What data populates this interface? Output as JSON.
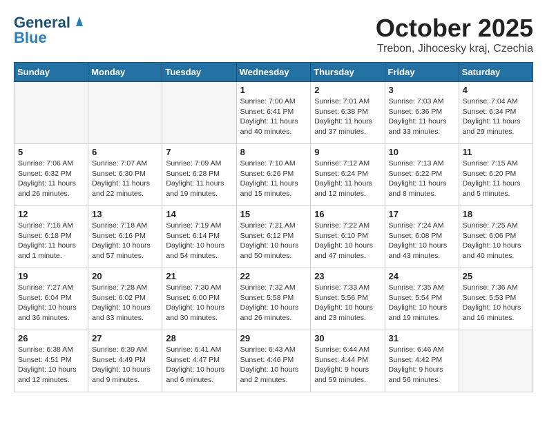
{
  "logo": {
    "part1": "General",
    "part2": "Blue"
  },
  "header": {
    "month": "October 2025",
    "location": "Trebon, Jihocesky kraj, Czechia"
  },
  "weekdays": [
    "Sunday",
    "Monday",
    "Tuesday",
    "Wednesday",
    "Thursday",
    "Friday",
    "Saturday"
  ],
  "weeks": [
    [
      {
        "day": "",
        "info": ""
      },
      {
        "day": "",
        "info": ""
      },
      {
        "day": "",
        "info": ""
      },
      {
        "day": "1",
        "info": "Sunrise: 7:00 AM\nSunset: 6:41 PM\nDaylight: 11 hours\nand 40 minutes."
      },
      {
        "day": "2",
        "info": "Sunrise: 7:01 AM\nSunset: 6:38 PM\nDaylight: 11 hours\nand 37 minutes."
      },
      {
        "day": "3",
        "info": "Sunrise: 7:03 AM\nSunset: 6:36 PM\nDaylight: 11 hours\nand 33 minutes."
      },
      {
        "day": "4",
        "info": "Sunrise: 7:04 AM\nSunset: 6:34 PM\nDaylight: 11 hours\nand 29 minutes."
      }
    ],
    [
      {
        "day": "5",
        "info": "Sunrise: 7:06 AM\nSunset: 6:32 PM\nDaylight: 11 hours\nand 26 minutes."
      },
      {
        "day": "6",
        "info": "Sunrise: 7:07 AM\nSunset: 6:30 PM\nDaylight: 11 hours\nand 22 minutes."
      },
      {
        "day": "7",
        "info": "Sunrise: 7:09 AM\nSunset: 6:28 PM\nDaylight: 11 hours\nand 19 minutes."
      },
      {
        "day": "8",
        "info": "Sunrise: 7:10 AM\nSunset: 6:26 PM\nDaylight: 11 hours\nand 15 minutes."
      },
      {
        "day": "9",
        "info": "Sunrise: 7:12 AM\nSunset: 6:24 PM\nDaylight: 11 hours\nand 12 minutes."
      },
      {
        "day": "10",
        "info": "Sunrise: 7:13 AM\nSunset: 6:22 PM\nDaylight: 11 hours\nand 8 minutes."
      },
      {
        "day": "11",
        "info": "Sunrise: 7:15 AM\nSunset: 6:20 PM\nDaylight: 11 hours\nand 5 minutes."
      }
    ],
    [
      {
        "day": "12",
        "info": "Sunrise: 7:16 AM\nSunset: 6:18 PM\nDaylight: 11 hours\nand 1 minute."
      },
      {
        "day": "13",
        "info": "Sunrise: 7:18 AM\nSunset: 6:16 PM\nDaylight: 10 hours\nand 57 minutes."
      },
      {
        "day": "14",
        "info": "Sunrise: 7:19 AM\nSunset: 6:14 PM\nDaylight: 10 hours\nand 54 minutes."
      },
      {
        "day": "15",
        "info": "Sunrise: 7:21 AM\nSunset: 6:12 PM\nDaylight: 10 hours\nand 50 minutes."
      },
      {
        "day": "16",
        "info": "Sunrise: 7:22 AM\nSunset: 6:10 PM\nDaylight: 10 hours\nand 47 minutes."
      },
      {
        "day": "17",
        "info": "Sunrise: 7:24 AM\nSunset: 6:08 PM\nDaylight: 10 hours\nand 43 minutes."
      },
      {
        "day": "18",
        "info": "Sunrise: 7:25 AM\nSunset: 6:06 PM\nDaylight: 10 hours\nand 40 minutes."
      }
    ],
    [
      {
        "day": "19",
        "info": "Sunrise: 7:27 AM\nSunset: 6:04 PM\nDaylight: 10 hours\nand 36 minutes."
      },
      {
        "day": "20",
        "info": "Sunrise: 7:28 AM\nSunset: 6:02 PM\nDaylight: 10 hours\nand 33 minutes."
      },
      {
        "day": "21",
        "info": "Sunrise: 7:30 AM\nSunset: 6:00 PM\nDaylight: 10 hours\nand 30 minutes."
      },
      {
        "day": "22",
        "info": "Sunrise: 7:32 AM\nSunset: 5:58 PM\nDaylight: 10 hours\nand 26 minutes."
      },
      {
        "day": "23",
        "info": "Sunrise: 7:33 AM\nSunset: 5:56 PM\nDaylight: 10 hours\nand 23 minutes."
      },
      {
        "day": "24",
        "info": "Sunrise: 7:35 AM\nSunset: 5:54 PM\nDaylight: 10 hours\nand 19 minutes."
      },
      {
        "day": "25",
        "info": "Sunrise: 7:36 AM\nSunset: 5:53 PM\nDaylight: 10 hours\nand 16 minutes."
      }
    ],
    [
      {
        "day": "26",
        "info": "Sunrise: 6:38 AM\nSunset: 4:51 PM\nDaylight: 10 hours\nand 12 minutes."
      },
      {
        "day": "27",
        "info": "Sunrise: 6:39 AM\nSunset: 4:49 PM\nDaylight: 10 hours\nand 9 minutes."
      },
      {
        "day": "28",
        "info": "Sunrise: 6:41 AM\nSunset: 4:47 PM\nDaylight: 10 hours\nand 6 minutes."
      },
      {
        "day": "29",
        "info": "Sunrise: 6:43 AM\nSunset: 4:46 PM\nDaylight: 10 hours\nand 2 minutes."
      },
      {
        "day": "30",
        "info": "Sunrise: 6:44 AM\nSunset: 4:44 PM\nDaylight: 9 hours\nand 59 minutes."
      },
      {
        "day": "31",
        "info": "Sunrise: 6:46 AM\nSunset: 4:42 PM\nDaylight: 9 hours\nand 56 minutes."
      },
      {
        "day": "",
        "info": ""
      }
    ]
  ]
}
